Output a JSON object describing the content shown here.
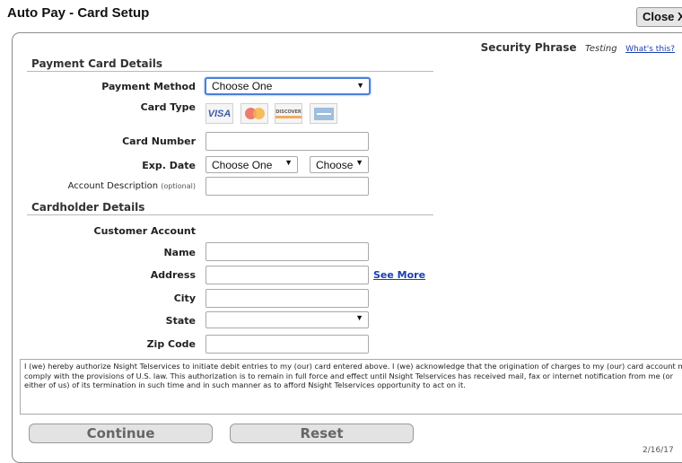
{
  "header": {
    "title": "Auto Pay - Card Setup",
    "close_label": "Close X"
  },
  "security": {
    "label": "Security Phrase",
    "value": "Testing",
    "link": "What's this?"
  },
  "payment_section": {
    "heading": "Payment Card Details",
    "payment_method": {
      "label": "Payment Method",
      "value": "Choose One"
    },
    "card_type": {
      "label": "Card Type",
      "cards": [
        "visa-icon",
        "mastercard-icon",
        "discover-icon",
        "amex-icon"
      ],
      "visa_text": "VISA",
      "discover_text": "DISCOVER"
    },
    "card_number": {
      "label": "Card Number",
      "value": ""
    },
    "exp_date": {
      "label": "Exp. Date",
      "month": "Choose One",
      "year": "Choose"
    },
    "account_description": {
      "label": "Account Description",
      "optional": "(optional)",
      "value": ""
    }
  },
  "cardholder_section": {
    "heading": "Cardholder Details",
    "customer_account_label": "Customer Account",
    "name_label": "Name",
    "address_label": "Address",
    "see_more": "See More",
    "city_label": "City",
    "state_label": "State",
    "state_value": "",
    "zip_label": "Zip Code"
  },
  "authorization_text": "I (we) hereby authorize Nsight Telservices to initiate debit entries to my (our) card entered above. I (we) acknowledge that the origination of charges to my (our) card account must comply with the provisions of U.S. law. This authorization is to remain in full force and effect until Nsight Telservices has received mail, fax or internet notification from me (or either of us) of its termination in such time and in such manner as to afford Nsight Telservices opportunity to act on it.",
  "buttons": {
    "continue": "Continue",
    "reset": "Reset"
  },
  "footer_date": "2/16/17",
  "colors": {
    "link": "#1a3fb0",
    "focus": "#4a7fd6",
    "button_bg": "#e3e3e3"
  }
}
